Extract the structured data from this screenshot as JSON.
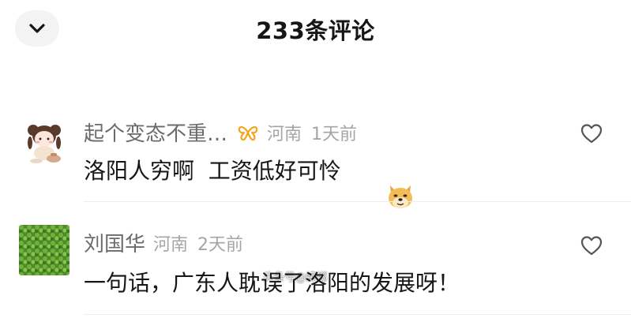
{
  "header": {
    "title": "233条评论",
    "back_icon": "chevron-down-icon"
  },
  "comments": [
    {
      "username": "起个变态不重…",
      "badge_icon": "bow-ribbon-icon",
      "badge_color": "#f2a71a",
      "location": "河南",
      "time": "1天前",
      "text": "洛阳人穷啊  工资低好可怜",
      "emoji_icon": "doge-emoji-icon",
      "watermark": "头条号@蟑螂",
      "like_icon": "heart-outline-icon"
    },
    {
      "username": "刘国华",
      "location": "河南",
      "time": "2天前",
      "text": "一句话，广东人耽误了洛阳的发展呀！",
      "like_icon": "heart-outline-icon"
    }
  ],
  "colors": {
    "text_primary": "#161616",
    "text_secondary": "#6b6b6b",
    "text_muted": "#a5a5a5",
    "divider": "#eeeeee"
  }
}
